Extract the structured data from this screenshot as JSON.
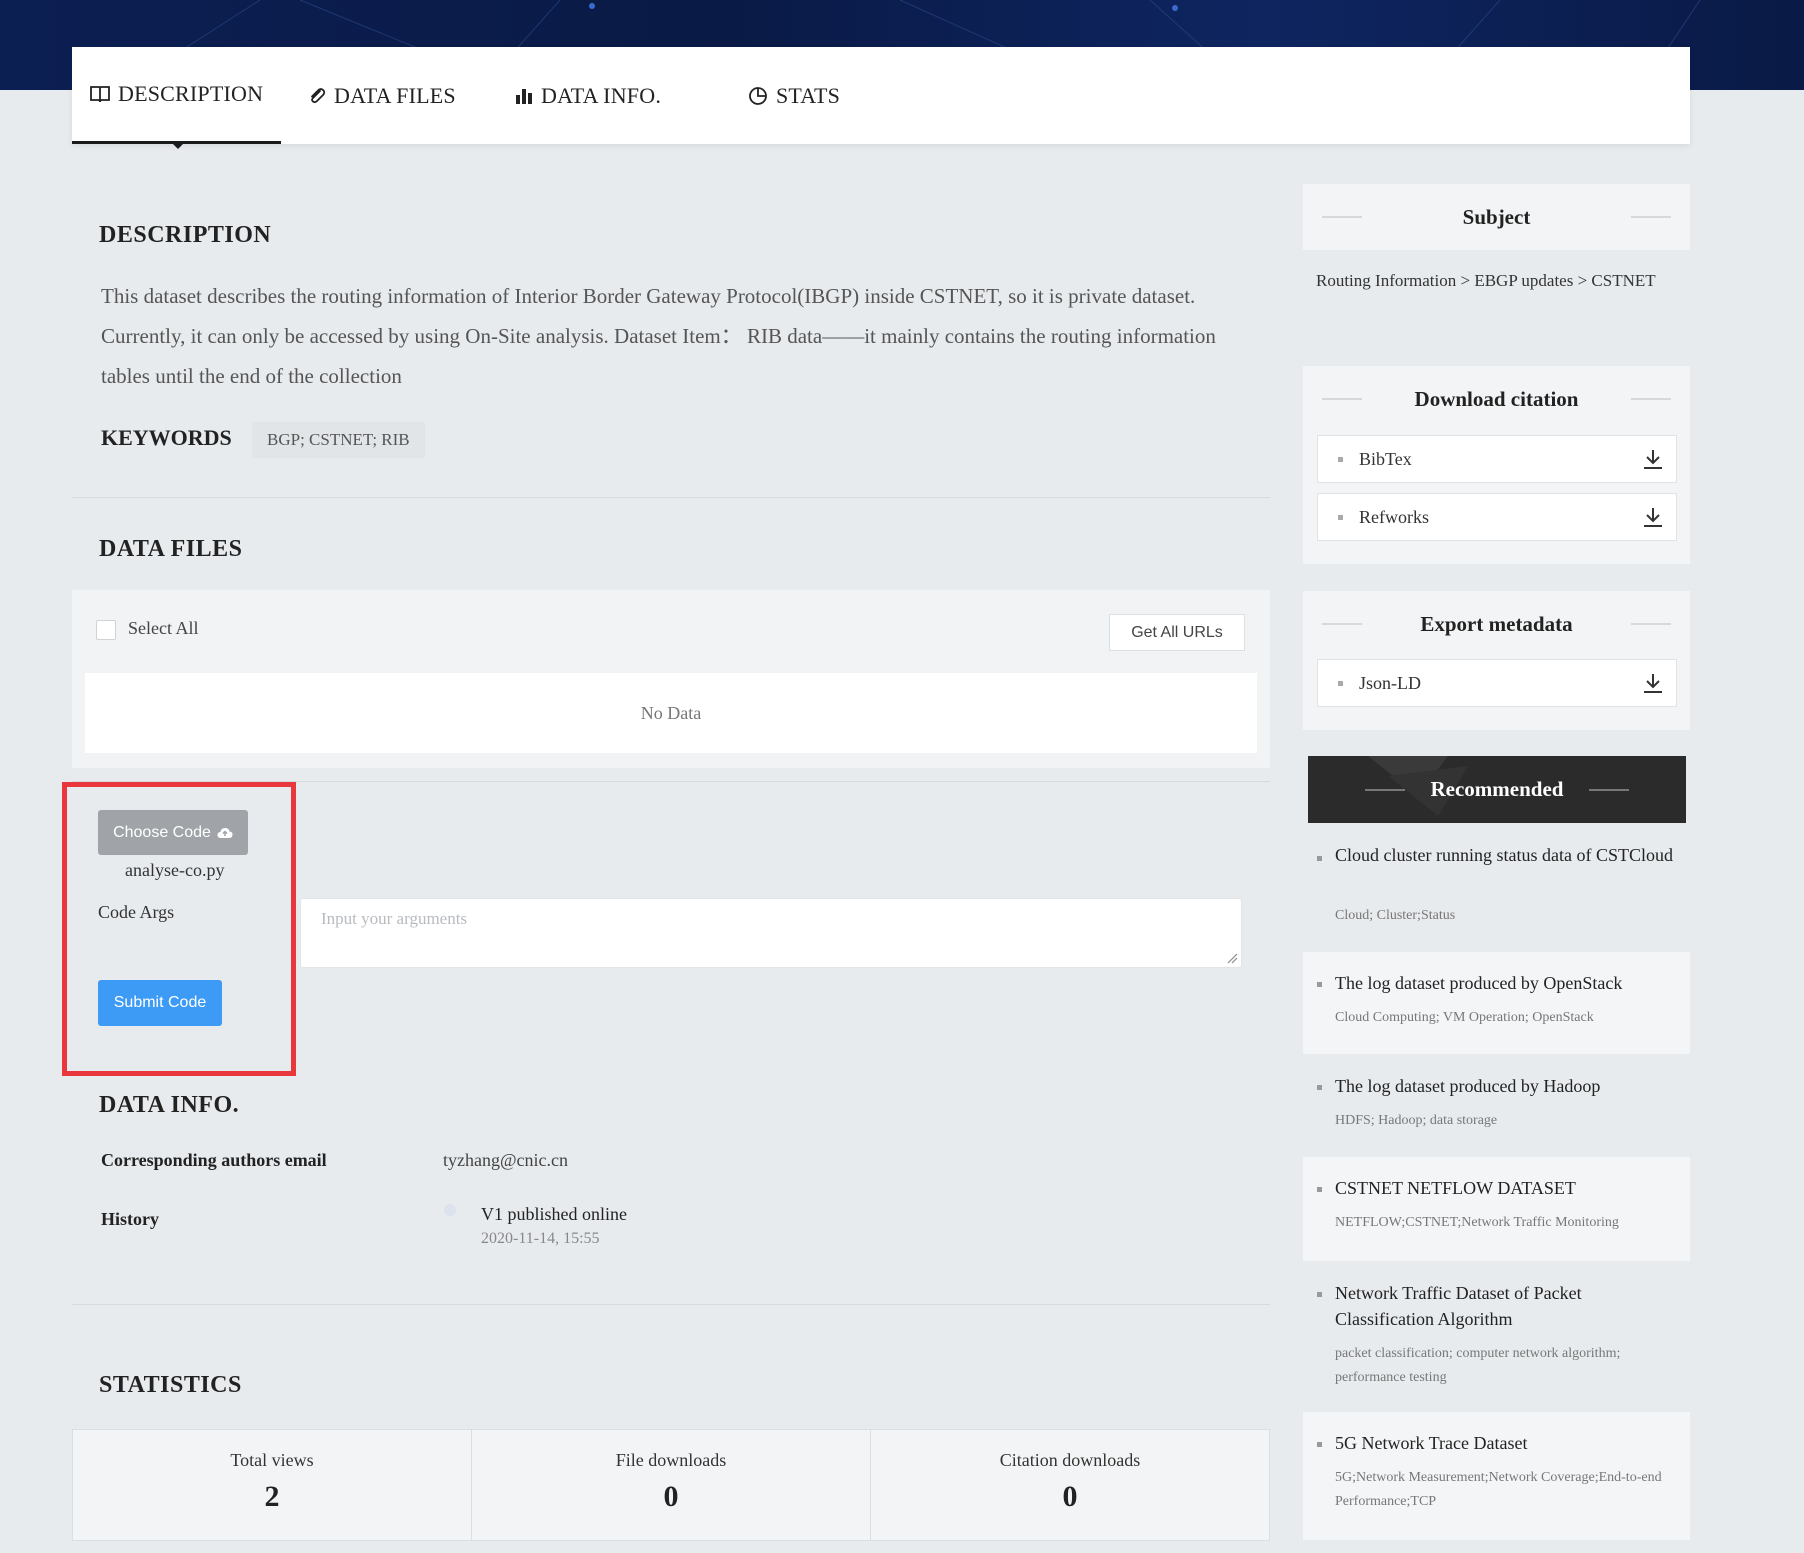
{
  "tabs": {
    "description": "DESCRIPTION",
    "data_files": "DATA FILES",
    "data_info": "DATA INFO.",
    "stats": "STATS"
  },
  "description": {
    "heading": "DESCRIPTION",
    "text": "This dataset describes the routing information of Interior Border Gateway Protocol(IBGP) inside CSTNET, so it is private dataset. Currently, it can only be accessed by using On-Site analysis. Dataset Item： RIB data——it mainly contains the routing information tables until the end of the collection",
    "keywords_label": "KEYWORDS",
    "keywords": "BGP; CSTNET; RIB"
  },
  "data_files": {
    "heading": "DATA FILES",
    "select_all": "Select All",
    "get_urls": "Get All URLs",
    "empty": "No Data"
  },
  "code": {
    "choose_label": "Choose Code",
    "filename": "analyse-co.py",
    "args_label": "Code Args",
    "args_placeholder": "Input your arguments",
    "args_value": "",
    "submit_label": "Submit Code"
  },
  "data_info": {
    "heading": "DATA INFO.",
    "email_label": "Corresponding authors email",
    "email": "tyzhang@cnic.cn",
    "history_label": "History",
    "history_event": "V1 published online",
    "history_date": "2020-11-14, 15:55"
  },
  "statistics": {
    "heading": "STATISTICS",
    "items": [
      {
        "label": "Total views",
        "value": "2"
      },
      {
        "label": "File downloads",
        "value": "0"
      },
      {
        "label": "Citation downloads",
        "value": "0"
      }
    ]
  },
  "sidebar": {
    "subject": {
      "heading": "Subject",
      "path": "Routing Information > EBGP updates > CSTNET"
    },
    "citation": {
      "heading": "Download citation",
      "items": [
        "BibTex",
        "Refworks"
      ]
    },
    "metadata": {
      "heading": "Export metadata",
      "items": [
        "Json-LD"
      ]
    },
    "recommended": {
      "heading": "Recommended",
      "items": [
        {
          "title": "Cloud cluster running status data of CSTCloud",
          "tags": "Cloud; Cluster;Status"
        },
        {
          "title": "The log dataset produced by OpenStack",
          "tags": "Cloud Computing; VM Operation; OpenStack"
        },
        {
          "title": "The log dataset produced by Hadoop",
          "tags": "HDFS; Hadoop; data storage"
        },
        {
          "title": "CSTNET NETFLOW DATASET",
          "tags": "NETFLOW;CSTNET;Network Traffic Monitoring"
        },
        {
          "title": "Network Traffic Dataset of Packet Classification Algorithm",
          "tags": "packet classification; computer network algorithm; performance testing"
        },
        {
          "title": "5G Network Trace Dataset",
          "tags": "5G;Network Measurement;Network Coverage;End-to-end Performance;TCP"
        }
      ]
    }
  },
  "colors": {
    "hero_bg": "#0c1f52",
    "submit_button": "#3d9bf5",
    "highlight_box": "#e8373d",
    "recommended_header": "#2b2b2b"
  }
}
